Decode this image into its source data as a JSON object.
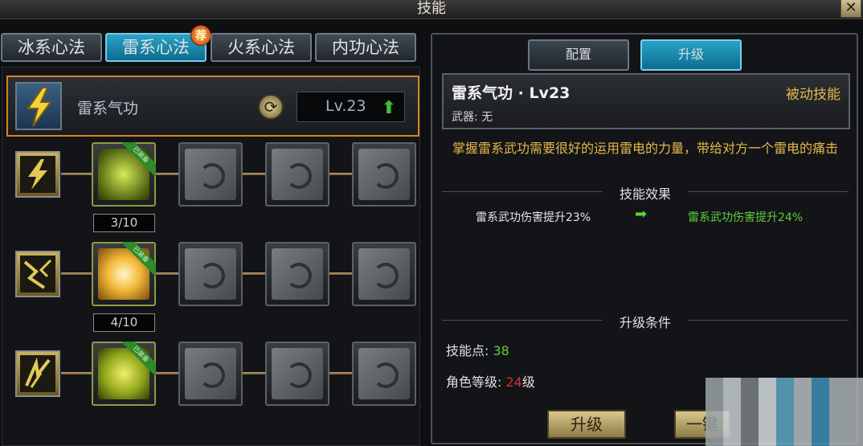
{
  "window": {
    "title": "技能",
    "close_label": "✕"
  },
  "left": {
    "tabs": [
      {
        "label": "冰系心法",
        "active": false
      },
      {
        "label": "雷系心法",
        "active": true,
        "badge": "荐"
      },
      {
        "label": "火系心法",
        "active": false
      },
      {
        "label": "内功心法",
        "active": false
      }
    ],
    "main_skill": {
      "icon": "lightning-icon",
      "name": "雷系气功",
      "level": "Lv.23",
      "refresh_icon": "refresh-icon",
      "upgrade_icon": "up-arrow-icon"
    },
    "tree_rows": [
      {
        "type_icon": "lightning-bolt-icon",
        "progress": "3/10",
        "learned_ribbon": "已装备",
        "locked_nodes": 3
      },
      {
        "type_icon": "shatter-icon",
        "progress": "4/10",
        "learned_ribbon": "已装备",
        "locked_nodes": 3
      },
      {
        "type_icon": "claw-strike-icon",
        "progress": "",
        "learned_ribbon": "已装备",
        "locked_nodes": 3
      }
    ]
  },
  "right": {
    "tabs": [
      {
        "label": "配置",
        "active": false
      },
      {
        "label": "升级",
        "active": true
      }
    ],
    "skill_title": "雷系气功 · Lv23",
    "skill_type": "被动技能",
    "weapon": "武器: 无",
    "description": "掌握雷系武功需要很好的运用雷电的力量，带给对方一个雷电的痛击",
    "effect_header": "技能效果",
    "effect_current": "雷系武功伤害提升23%",
    "effect_next": "雷系武功伤害提升24%",
    "effect_arrow": "➡",
    "requirements_header": "升级条件",
    "skill_points_label": "技能点:",
    "skill_points_value": "38",
    "role_level_label": "角色等级:",
    "role_level_value": "24",
    "role_level_suffix": "级",
    "upgrade_button": "升级",
    "secondary_button": "一键"
  },
  "colors": {
    "accent_blue": "#1a8fb8",
    "gold": "#e3b84a",
    "green": "#5fcf3a",
    "red": "#e02a2a",
    "orange_border": "#d9831f"
  }
}
